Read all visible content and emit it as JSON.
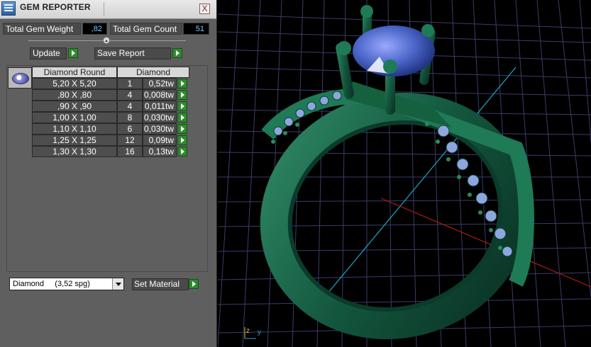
{
  "window": {
    "title": "GEM REPORTER",
    "close_label": "X"
  },
  "stats": {
    "total_weight_label": "Total Gem Weight",
    "total_weight_value": ",82",
    "total_count_label": "Total Gem Count",
    "total_count_value": "51"
  },
  "buttons": {
    "update": "Update",
    "save_report": "Save Report",
    "set_material": "Set Material"
  },
  "table": {
    "headers": [
      "Diamond Round",
      "Diamond"
    ],
    "rows": [
      {
        "size": "5,20 X 5,20",
        "count": "1",
        "weight": "0,52tw"
      },
      {
        "size": ",80 X ,80",
        "count": "4",
        "weight": "0,008tw"
      },
      {
        "size": ",90 X ,90",
        "count": "4",
        "weight": "0,011tw"
      },
      {
        "size": "1,00 X 1,00",
        "count": "8",
        "weight": "0,030tw"
      },
      {
        "size": "1,10 X 1,10",
        "count": "6",
        "weight": "0,030tw"
      },
      {
        "size": "1,25 X 1,25",
        "count": "12",
        "weight": "0,09tw"
      },
      {
        "size": "1,30 X 1,30",
        "count": "16",
        "weight": "0,13tw"
      }
    ]
  },
  "material": {
    "selected": "Diamond     (3,52 spg)"
  },
  "viewport": {
    "axis_labels": {
      "z": "z",
      "y": "y"
    },
    "grid_color": "#3b3b6e"
  }
}
